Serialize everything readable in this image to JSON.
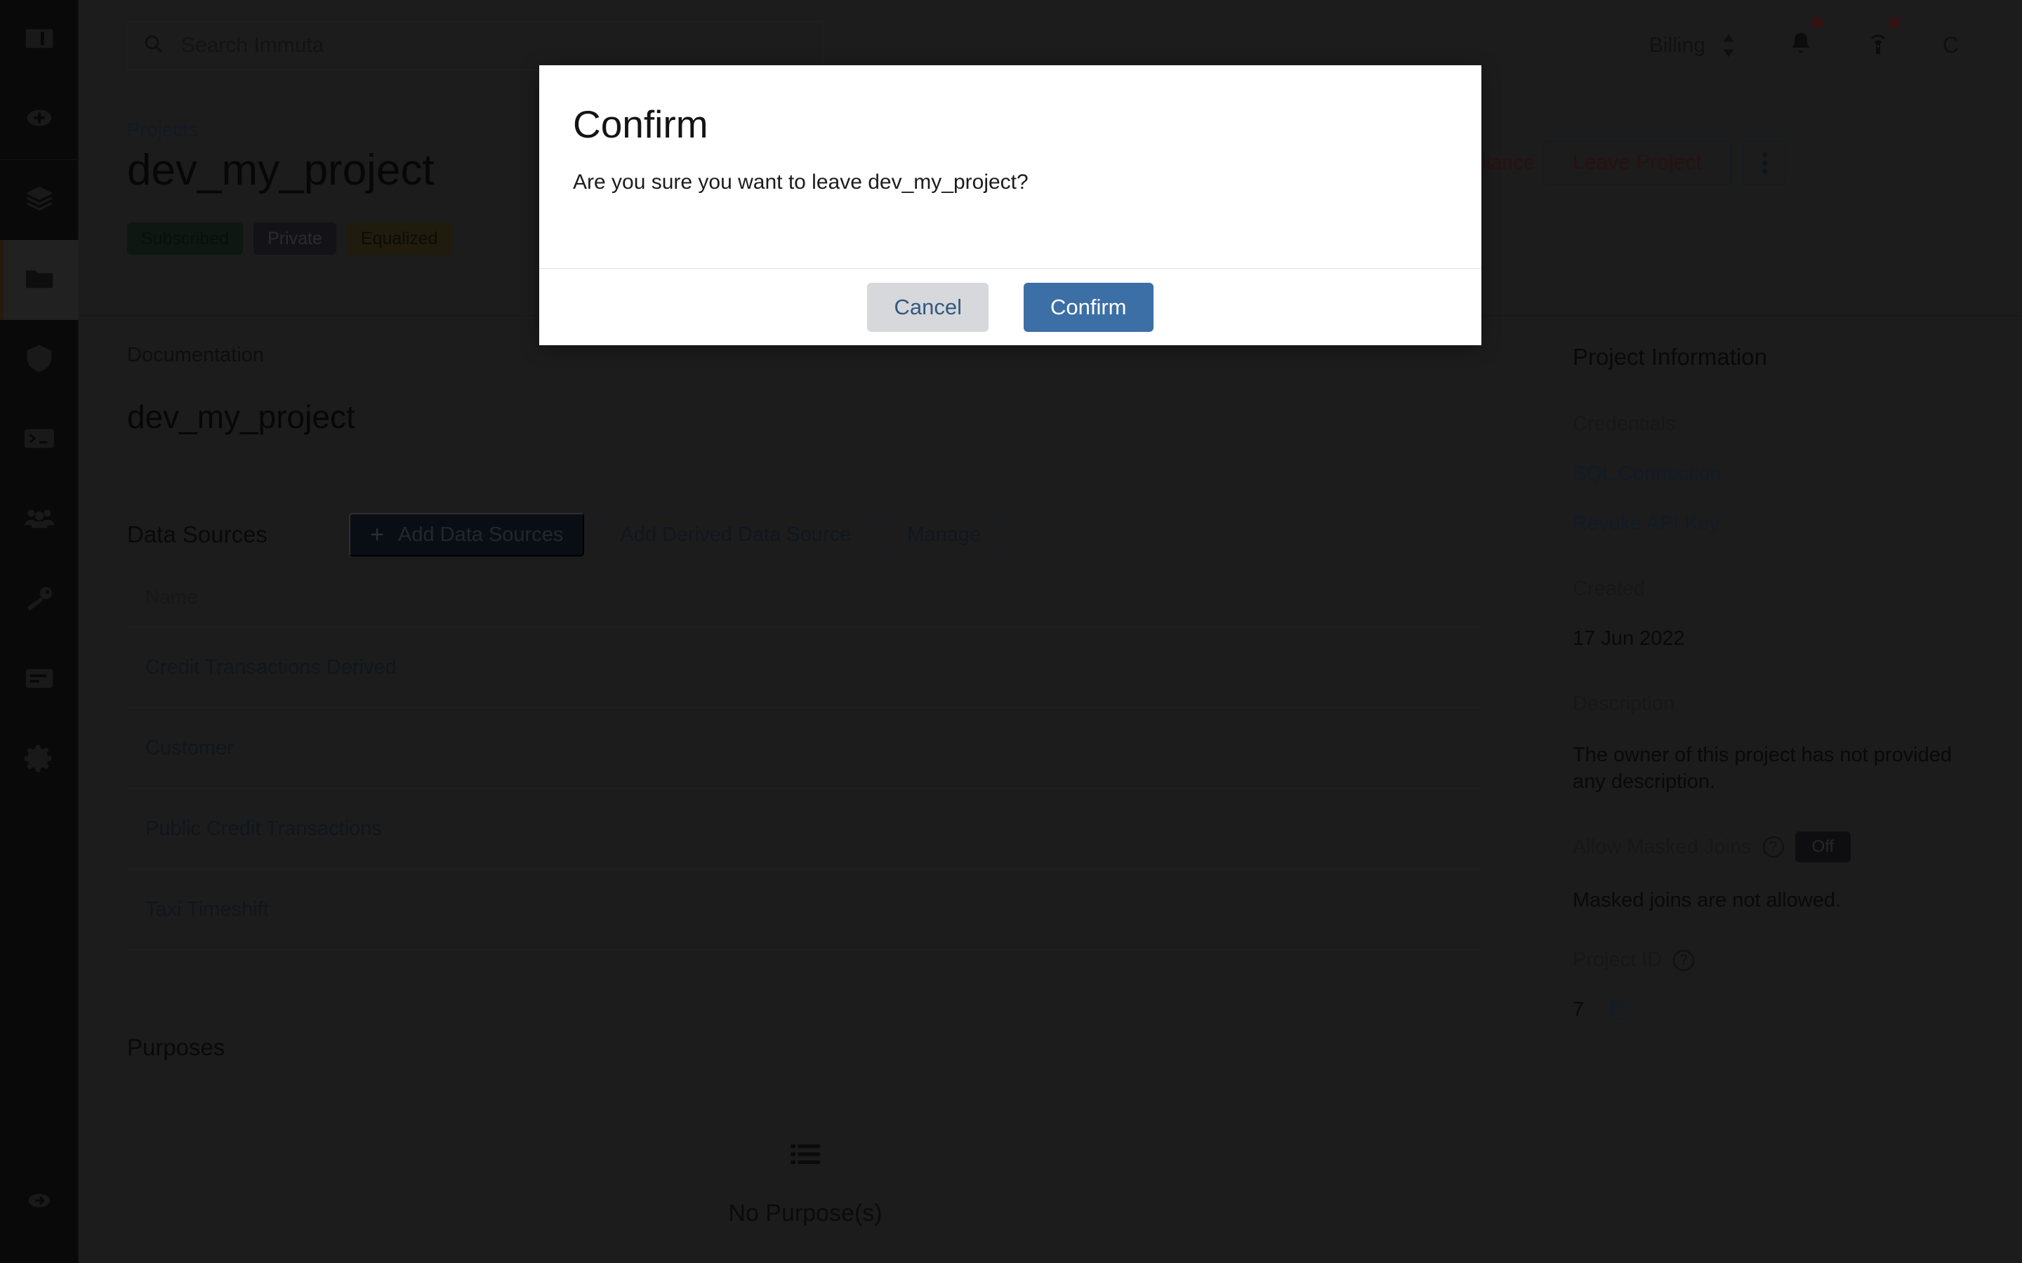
{
  "sidebar": {
    "items": [
      {
        "name": "panel-toggle",
        "icon": "panel-toggle-icon"
      },
      {
        "name": "add",
        "icon": "plus-circle-icon"
      },
      {
        "name": "data-sources",
        "icon": "layers-icon"
      },
      {
        "name": "projects",
        "icon": "folder-icon",
        "active": true
      },
      {
        "name": "policies",
        "icon": "shield-icon"
      },
      {
        "name": "query-engine",
        "icon": "terminal-icon"
      },
      {
        "name": "people",
        "icon": "users-icon"
      },
      {
        "name": "identity",
        "icon": "key-icon"
      },
      {
        "name": "audit",
        "icon": "report-icon"
      },
      {
        "name": "settings",
        "icon": "gear-icon"
      }
    ],
    "bottom": {
      "name": "logout",
      "icon": "logout-icon"
    }
  },
  "topbar": {
    "search_placeholder": "Search Immuta",
    "search_value": "",
    "search_icon": "search-icon",
    "billing_label": "Billing",
    "billing_chevron_icon": "chevron-updown-icon",
    "notifications_icon": "bell-icon",
    "notifications_has_badge": true,
    "broadcast_icon": "broadcast-icon",
    "broadcast_has_badge": true,
    "avatar_initial": "C"
  },
  "project_header": {
    "breadcrumb": "Projects",
    "title": "dev_my_project",
    "badges": [
      {
        "label": "Subscribed",
        "color": "#1a2a1f"
      },
      {
        "label": "Private",
        "color": "#21212b"
      },
      {
        "label": "Equalized",
        "color": "#3a3418"
      }
    ],
    "compliance_status": "Documentation Out of Compliance",
    "compliance_color": "#4a1f1f",
    "leave_project_label": "Leave Project",
    "more_menu_icon": "kebab-menu-icon"
  },
  "documentation": {
    "section_label": "Documentation",
    "title": "dev_my_project"
  },
  "data_sources": {
    "section_label": "Data Sources",
    "add_label": "Add Data Sources",
    "add_icon": "plus-icon",
    "add_derived_label": "Add Derived Data Source",
    "manage_label": "Manage",
    "columns": [
      "Name"
    ],
    "rows": [
      "Credit Transactions Derived",
      "Customer",
      "Public Credit Transactions",
      "Taxi Timeshift"
    ]
  },
  "purposes": {
    "section_label": "Purposes",
    "empty_icon": "list-icon",
    "empty_text": "No Purpose(s)"
  },
  "project_information": {
    "title": "Project Information",
    "credentials_label": "Credentials",
    "sql_connection_label": "SQL Connection",
    "revoke_api_key_label": "Revoke API Key",
    "created_label": "Created",
    "created_value": "17 Jun 2022",
    "description_label": "Description",
    "description_value": "The owner of this project has not provided any description.",
    "allow_masked_joins_label": "Allow Masked Joins",
    "allow_masked_joins_help_icon": "help-icon",
    "allow_masked_joins_toggle": "Off",
    "masked_joins_note": "Masked joins are not allowed.",
    "project_id_label": "Project ID",
    "project_id_help_icon": "help-icon",
    "project_id_value": "7",
    "project_id_copy_icon": "copy-icon"
  },
  "modal": {
    "title": "Confirm",
    "message": "Are you sure you want to leave dev_my_project?",
    "cancel_label": "Cancel",
    "confirm_label": "Confirm",
    "confirm_color": "#3c6fa5",
    "cancel_color": "#d6d8db"
  }
}
